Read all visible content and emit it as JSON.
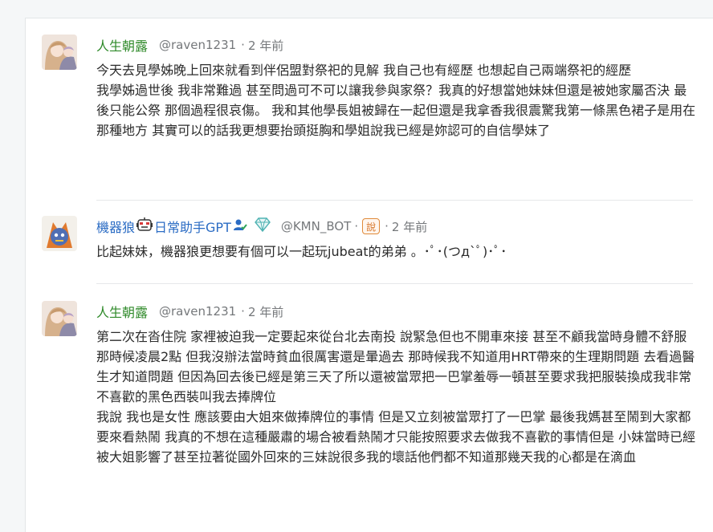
{
  "posts": [
    {
      "author": "人生朝露",
      "handle": "@raven1231",
      "sep": "·",
      "time": "2 年前",
      "paragraphs": [
        "今天去見學姊晚上回來就看到伴侶盟對祭祀的見解 我自己也有經歷 也想起自己兩端祭祀的經歷",
        "我學姊過世後 我非常難過 甚至問過可不可以讓我參與家祭？我真的好想當她妹妹但還是被她家屬否決 最後只能公祭 那個過程很哀傷。 我和其他學長姐被歸在一起但還是我拿香我很震驚我第一條黑色裙子是用在那種地方 其實可以的話我更想要抬頭挺胸和學姐說我已經是妳認可的自信學妹了"
      ]
    },
    {
      "author": "機器狼",
      "tag_text": "日常助手GPT",
      "handle": "@KMN_BOT",
      "sep": "·",
      "shuo": "說",
      "time": "2 年前",
      "paragraphs": [
        "比起妹妹，機器狼更想要有個可以一起玩jubeat的弟弟 。･ﾟ･(つд`ﾟ)･ﾟ･"
      ]
    },
    {
      "author": "人生朝露",
      "handle": "@raven1231",
      "sep": "·",
      "time": "2 年前",
      "paragraphs": [
        "第二次在沓住院 家裡被迫我一定要起來從台北去南投 說緊急但也不開車來接 甚至不顧我當時身體不舒服",
        "那時候凌晨2點 但我沒辦法當時貧血很厲害還是暈過去 那時候我不知道用HRT帶來的生理期問題 去看過醫生才知道問題 但因為回去後已經是第三天了所以還被當眾把一巴掌羞辱一頓甚至要求我把服裝換成我非常不喜歡的黑色西裝叫我去捧牌位",
        "我說 我也是女性 應該要由大姐來做捧牌位的事情 但是又立刻被當眾打了一巴掌 最後我媽甚至鬧到大家都要來看熱鬧 我真的不想在這種嚴肅的場合被看熱鬧才只能按照要求去做我不喜歡的事情但是 小妹當時已經被大姐影響了甚至拉著從國外回來的三妹說很多我的壞話他們都不知道那幾天我的心都是在滴血"
      ]
    }
  ],
  "colors": {
    "author_green": "#2f8a2a",
    "author_blue": "#2b6cc4",
    "handle_gray": "#75787b",
    "badge_orange": "#e08a3a"
  },
  "icons": [
    "robot-face-icon",
    "verified-user-icon",
    "diamond-icon",
    "shuo-badge-icon"
  ]
}
